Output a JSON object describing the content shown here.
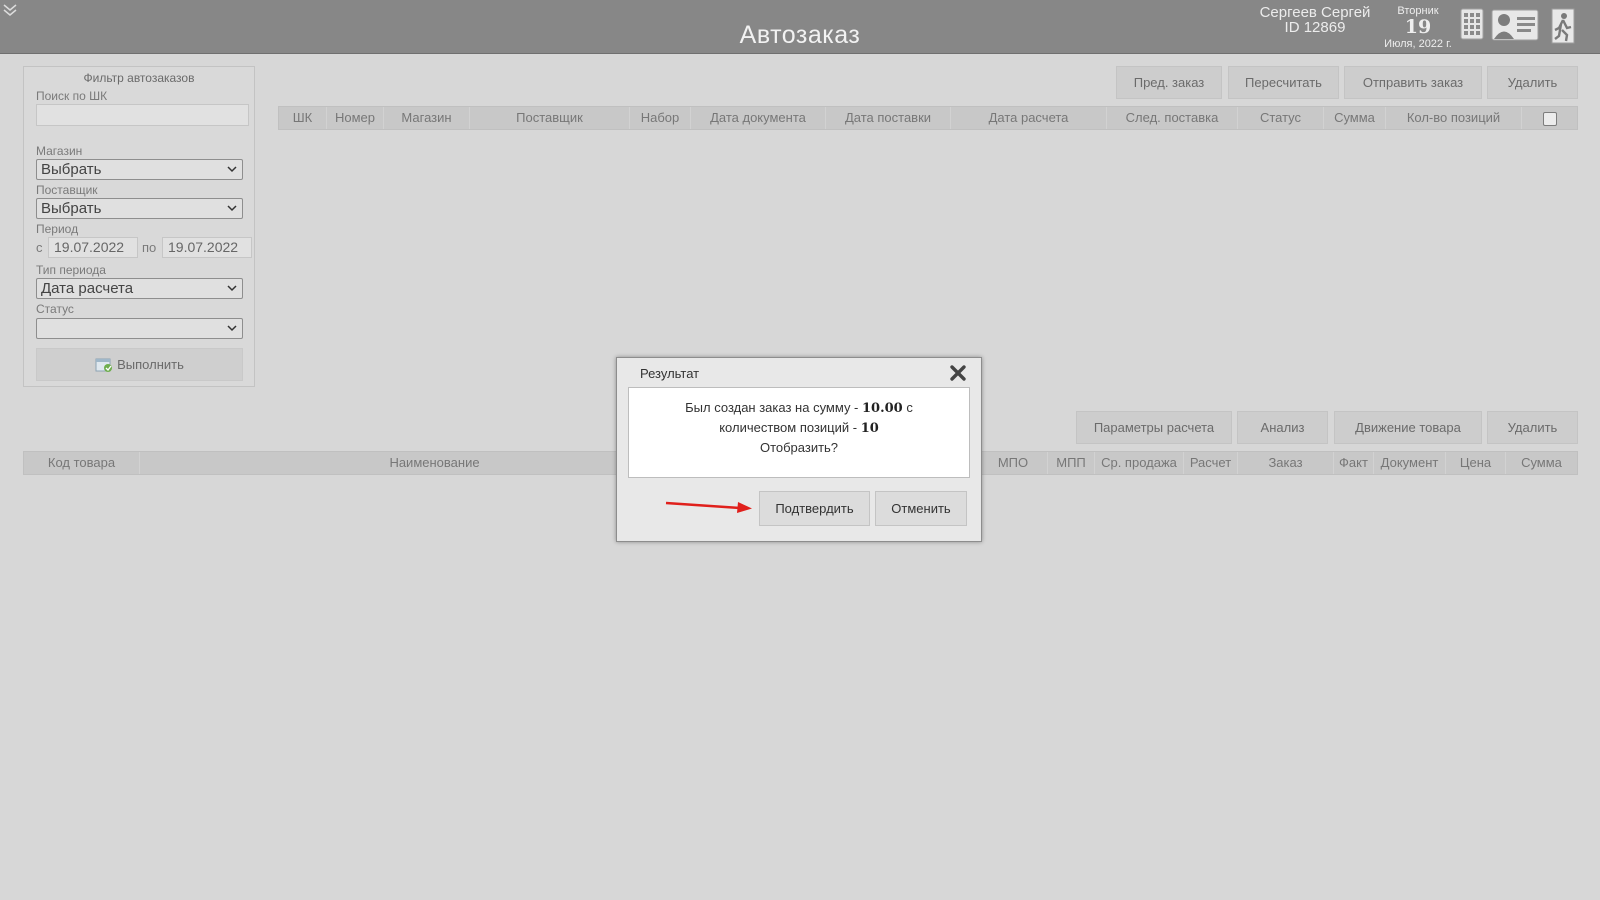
{
  "header": {
    "title": "Автозаказ",
    "user_name": "Сергеев Сергей",
    "user_id": "ID 12869",
    "weekday": "Вторник",
    "day": "19",
    "month_year": "Июля, 2022 г."
  },
  "filter": {
    "title": "Фильтр автозаказов",
    "search_label": "Поиск по ШК",
    "search_value": "",
    "store_label": "Магазин",
    "store_value": "Выбрать",
    "supplier_label": "Поставщик",
    "supplier_value": "Выбрать",
    "period_label": "Период",
    "from_label": "с",
    "from_value": "19.07.2022",
    "to_label": "по",
    "to_value": "19.07.2022",
    "period_type_label": "Тип периода",
    "period_type_value": "Дата расчета",
    "status_label": "Статус",
    "status_value": "",
    "run_label": "Выполнить"
  },
  "orders_toolbar": {
    "prev_order": "Пред. заказ",
    "recalc": "Пересчитать",
    "send_order": "Отправить заказ",
    "delete": "Удалить"
  },
  "orders_table": {
    "columns": [
      "ШК",
      "Номер",
      "Магазин",
      "Поставщик",
      "Набор",
      "Дата документа",
      "Дата поставки",
      "Дата расчета",
      "След. поставка",
      "Статус",
      "Сумма",
      "Кол-во позиций"
    ]
  },
  "items_toolbar": {
    "calc_params": "Параметры расчета",
    "analysis": "Анализ",
    "goods_movement": "Движение товара",
    "delete": "Удалить"
  },
  "items_table": {
    "columns": [
      "Код товара",
      "Наименование",
      "МПО",
      "МПП",
      "Ср. продажа",
      "Расчет",
      "Заказ",
      "Факт",
      "Документ",
      "Цена",
      "Сумма"
    ]
  },
  "dialog": {
    "title": "Результат",
    "line1_text": "Был создан заказ на сумму - ",
    "sum": "10.00",
    "line1_suffix": " с",
    "line2_text": "количеством позиций - ",
    "count": "10",
    "line3": "Отобразить?",
    "confirm": "Подтвердить",
    "cancel": "Отменить"
  },
  "colors": {
    "header_bg": "#878787",
    "page_bg": "#d7d7d7",
    "annotation_arrow": "#e0201c"
  }
}
